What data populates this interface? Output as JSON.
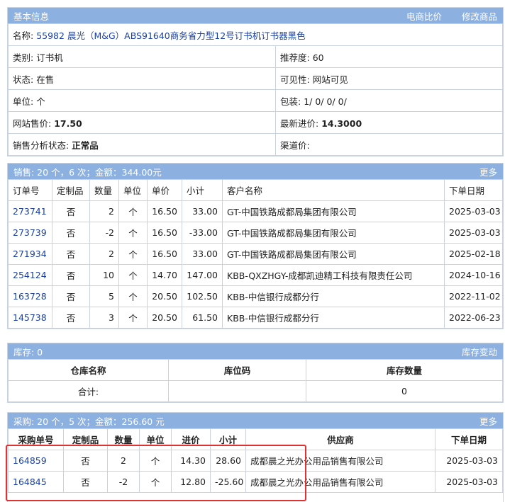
{
  "basic": {
    "title": "基本信息",
    "compare": "电商比价",
    "edit": "修改商品",
    "name_label": "名称:",
    "name_value": "55982 晨光（M&G）ABS91640商务省力型12号订书机订书器黑色",
    "rows": [
      {
        "l1": "类别:",
        "v1": "订书机",
        "b1": false,
        "l2": "推荐度:",
        "v2": "60",
        "b2": false
      },
      {
        "l1": "状态:",
        "v1": "在售",
        "b1": false,
        "l2": "可见性:",
        "v2": "网站可见",
        "b2": false
      },
      {
        "l1": "单位:",
        "v1": "个",
        "b1": false,
        "l2": "包装:",
        "v2": "1/ 0/ 0/ 0/",
        "b2": false
      },
      {
        "l1": "网站售价:",
        "v1": "17.50",
        "b1": true,
        "l2": "最新进价:",
        "v2": "14.3000",
        "b2": true
      },
      {
        "l1": "销售分析状态:",
        "v1": "正常品",
        "b1": true,
        "l2": "渠道价:",
        "v2": "",
        "b2": false
      }
    ]
  },
  "sales": {
    "summary": "销售:  20 个，6 次；金额：344.00元",
    "more": "更多",
    "columns": [
      "订单号",
      "定制品",
      "数量",
      "单位",
      "单价",
      "小计",
      "客户名称",
      "下单日期"
    ],
    "rows": [
      [
        "273741",
        "否",
        "2",
        "个",
        "16.50",
        "33.00",
        "GT-中国铁路成都局集团有限公司",
        "2025-03-03"
      ],
      [
        "273739",
        "否",
        "-2",
        "个",
        "16.50",
        "-33.00",
        "GT-中国铁路成都局集团有限公司",
        "2025-03-03"
      ],
      [
        "271934",
        "否",
        "2",
        "个",
        "16.50",
        "33.00",
        "GT-中国铁路成都局集团有限公司",
        "2025-02-18"
      ],
      [
        "254124",
        "否",
        "10",
        "个",
        "14.70",
        "147.00",
        "KBB-QXZHGY-成都凯迪精工科技有限责任公司",
        "2024-10-16"
      ],
      [
        "163728",
        "否",
        "5",
        "个",
        "20.50",
        "102.50",
        "KBB-中信银行成都分行",
        "2022-11-02"
      ],
      [
        "145738",
        "否",
        "3",
        "个",
        "20.50",
        "61.50",
        "KBB-中信银行成都分行",
        "2022-06-23"
      ]
    ]
  },
  "stock": {
    "summary": "库存:  0",
    "change": "库存变动",
    "columns": [
      "仓库名称",
      "库位码",
      "库存数量"
    ],
    "total_label": "合计:",
    "total_qty": "0"
  },
  "purchase": {
    "summary": "采购:  20 个，5 次；金额：256.60 元",
    "more": "更多",
    "columns": [
      "采购单号",
      "定制品",
      "数量",
      "单位",
      "进价",
      "小计",
      "供应商",
      "下单日期"
    ],
    "rows": [
      [
        "164859",
        "否",
        "2",
        "个",
        "14.30",
        "28.60",
        "成都晨之光办公用品销售有限公司",
        "2025-03-03"
      ],
      [
        "164845",
        "否",
        "-2",
        "个",
        "12.80",
        "-25.60",
        "成都晨之光办公用品销售有限公司",
        "2025-03-03"
      ]
    ]
  },
  "colors": {
    "header_bg": "#8cb0e0",
    "link": "#1a3fa6",
    "highlight": "#e03232",
    "border": "#c9d3e0"
  }
}
